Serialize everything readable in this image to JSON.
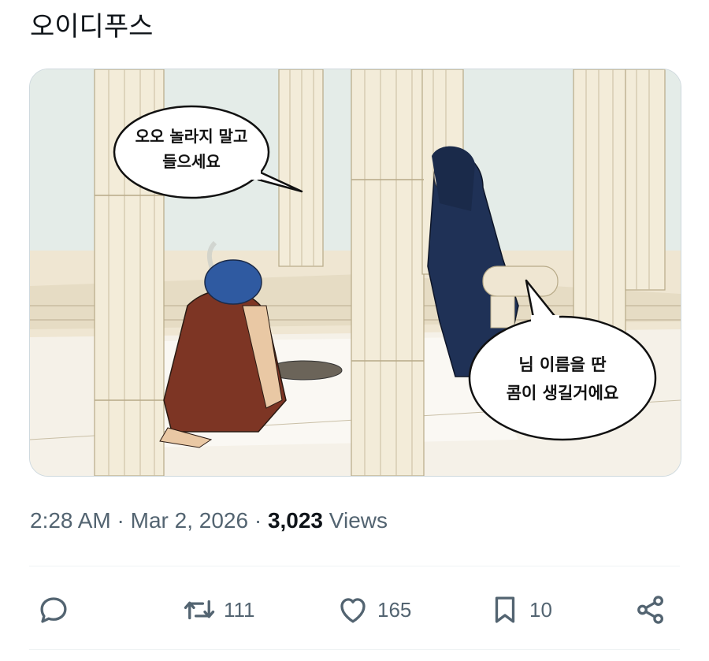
{
  "tweet": {
    "text": "오이디푸스"
  },
  "media": {
    "speech_bubble_1": [
      "오오 놀라지 말고",
      "들으세요"
    ],
    "speech_bubble_2": [
      "님 이름을 딴",
      "콤이 생길거에요"
    ]
  },
  "meta": {
    "time": "2:28 AM",
    "separator": "·",
    "date": "Mar 2, 2026",
    "views_count": "3,023",
    "views_label": "Views"
  },
  "actions": {
    "reply": {
      "icon": "reply-icon",
      "count": ""
    },
    "retweet": {
      "icon": "retweet-icon",
      "count": "111"
    },
    "like": {
      "icon": "heart-icon",
      "count": "165"
    },
    "bookmark": {
      "icon": "bookmark-icon",
      "count": "10"
    },
    "share": {
      "icon": "share-icon"
    }
  },
  "colors": {
    "text_primary": "#0f1419",
    "text_secondary": "#536471",
    "divider": "#eff3f4"
  }
}
